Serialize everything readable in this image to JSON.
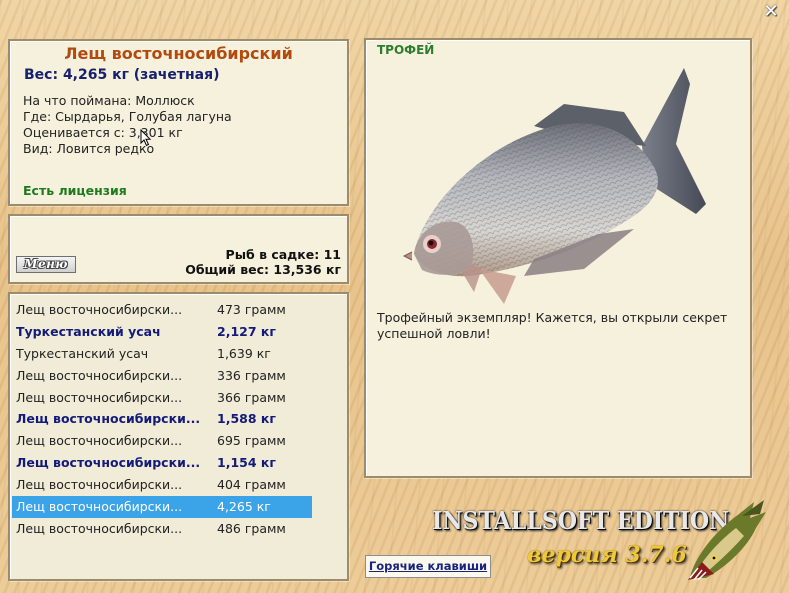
{
  "close_symbol": "✕",
  "info": {
    "fish_name": "Лещ восточносибирский",
    "weight_text": "Вес: 4,265 кг (зачетная)",
    "bait": "На что поймана: Моллюск",
    "location": "Где: Сырдарья, Голубая лагуна",
    "value": "Оценивается с: 3,301 кг",
    "rarity": "Вид: Ловится редко",
    "license": "Есть лицензия"
  },
  "creel": {
    "menu_label": "Меню",
    "fish_count": "Рыб в садке: 11",
    "total_weight": "Общий вес: 13,536 кг"
  },
  "catch_list": [
    {
      "name": "Лещ восточносибирски...",
      "weight": "473 грамм",
      "bold": false,
      "selected": false
    },
    {
      "name": "Туркестанский усач",
      "weight": "2,127 кг",
      "bold": true,
      "selected": false
    },
    {
      "name": "Туркестанский усач",
      "weight": "1,639 кг",
      "bold": false,
      "selected": false
    },
    {
      "name": "Лещ восточносибирски...",
      "weight": "336 грамм",
      "bold": false,
      "selected": false
    },
    {
      "name": "Лещ восточносибирски...",
      "weight": "366 грамм",
      "bold": false,
      "selected": false
    },
    {
      "name": "Лещ восточносибирски...",
      "weight": "1,588 кг",
      "bold": true,
      "selected": false
    },
    {
      "name": "Лещ восточносибирски...",
      "weight": "695 грамм",
      "bold": false,
      "selected": false
    },
    {
      "name": "Лещ восточносибирски...",
      "weight": "1,154 кг",
      "bold": true,
      "selected": false
    },
    {
      "name": "Лещ восточносибирски...",
      "weight": "404 грамм",
      "bold": false,
      "selected": false
    },
    {
      "name": "Лещ восточносибирски...",
      "weight": "4,265 кг",
      "bold": false,
      "selected": true
    },
    {
      "name": "Лещ восточносибирски...",
      "weight": "486 грамм",
      "bold": false,
      "selected": false
    }
  ],
  "trophy": {
    "label": "ТРОФЕЙ",
    "description": "Трофейный экземпляр! Кажется, вы открыли секрет успешной ловли!"
  },
  "footer": {
    "hotkeys_label": "Горячие клавиши",
    "edition": "INSTALLSOFT EDITION",
    "version": "версия 3.7.6"
  },
  "colors": {
    "selection": "#3ba3e8",
    "bold_row": "#131a78",
    "name_title": "#b24a10",
    "license": "#1e7a1e"
  }
}
